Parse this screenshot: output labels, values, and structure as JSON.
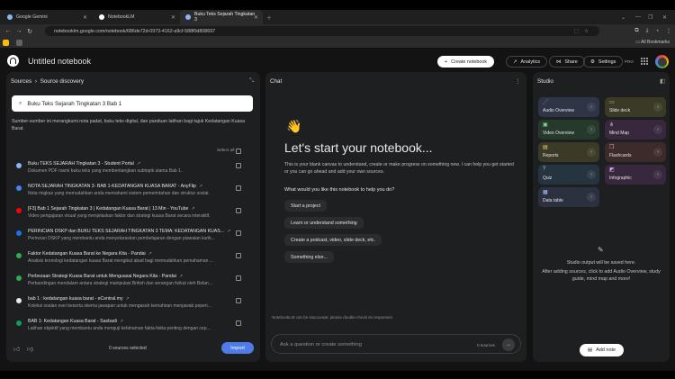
{
  "browser": {
    "tabs": [
      {
        "label": "Google Gemini",
        "color": "#8ab4f8"
      },
      {
        "label": "NotebookLM",
        "color": "#ffffff"
      },
      {
        "label": "Buku Teks Sejarah Tingkatan 3",
        "color": "#8ab4f8"
      }
    ],
    "url": "notebooklm.google.com/notebook/686de72d-0973-4162-a9cf-588f0d808697",
    "bookmarks_label": "All Bookmarks"
  },
  "header": {
    "title": "Untitled notebook",
    "create_label": "Create notebook",
    "analytics_label": "Analytics",
    "share_label": "Share",
    "settings_label": "Settings",
    "plan_badge": "PRO"
  },
  "sources": {
    "breadcrumb_root": "Sources",
    "breadcrumb_sep": "›",
    "breadcrumb_current": "Source discovery",
    "query": "Buku Teks Sejarah Tingkatan 3 Bab 1",
    "description": "Sumber-sumber ini merangkumi nota padat, buku teks digital, dan panduan latihan bagi tajuk Kedatangan Kuasa Barat.",
    "select_all_label": "Select all",
    "items": [
      {
        "title": "Buku TEKS SEJARAH Tingkatan 3 - Student Portal",
        "desc": "Dokumen PDF rasmi buku teks yang membentangkan subtopik utama Bab 1.",
        "icon_color": "#8ab4f8",
        "icon": "globe-icon"
      },
      {
        "title": "NOTA SEJARAH TINGKATAN 3- BAB 1-KEDATANGAN KUASA BARAT - AnyFlip",
        "desc": "Nota ringkas yang memudahkan anda memahami sistem pemerintahan dan struktur sosial.",
        "icon_color": "#4285f4",
        "icon": "anyflip-icon"
      },
      {
        "title": "[F3] Bab 1 Sejarah Tingkatan 3 | Kedatangan Kuasa Barat | 13 Min - YouTube",
        "desc": "Video pengajaran visual yang menjelaskan faktor dan strategi kuasa Barat secara interaktif.",
        "icon_color": "#ff0000",
        "icon": "youtube-icon"
      },
      {
        "title": "PERINCIAN DSKP dan BUKU TEKS SEJARAH TINGKATAN 3 TEMA: KEDATANGAN KUAS...",
        "desc": "Perincian DSKP yang membantu anda menyelaraskan pembelajaran dengan piawaian kurik...",
        "icon_color": "#1a73e8",
        "icon": "document-icon"
      },
      {
        "title": "Faktor Kedatangan Kuasa Barat ke Negara Kita - Pandai",
        "desc": "Analisis kronologi kedatangan kuasa Barat mengikut abad bagi memudahkan pemahaman ...",
        "icon_color": "#34a853",
        "icon": "pandai-icon"
      },
      {
        "title": "Perbezaan Strategi Kuasa Barat untuk Menguasai Negara Kita - Pandai",
        "desc": "Perbandingan mendalam antara strategi manipulasi British dan serangan fizikal oleh Belan...",
        "icon_color": "#34a853",
        "icon": "pandai-icon"
      },
      {
        "title": "bab 1 : kedatangan kuasa barat - eCentral.my",
        "desc": "Koleksi soalan esei beserta skema jawapan untuk mengasah kemahiran menjawab peperi...",
        "icon_color": "#e8eaed",
        "icon": "ecentral-icon"
      },
      {
        "title": "BAB 1: Kedatangan Kuasa Barat - Sasbadi",
        "desc": "Latihan objektif yang membantu anda menguji kefahaman fakta-fakta penting dengan cep...",
        "icon_color": "#0f9d58",
        "icon": "sasbadi-icon"
      }
    ],
    "selected_count": "0 sources selected",
    "import_label": "Import"
  },
  "chat": {
    "title": "Chat",
    "emoji": "👋",
    "heading": "Let's start your notebook...",
    "description": "This is your blank canvas to understand, create or make progress on something new. I can help you get started or you can go ahead and add your own sources.",
    "prompt": "What would you like this notebook to help you do?",
    "suggestions": [
      "Start a project",
      "Learn or understand something",
      "Create a podcast, video, slide deck, etc.",
      "Something else..."
    ],
    "input_placeholder": "Ask a question or create something",
    "source_count": "0 sources",
    "disclaimer": "NotebookLM can be inaccurate; please double-check its responses."
  },
  "studio": {
    "title": "Studio",
    "tiles": [
      {
        "label": "Audio Overview",
        "icon": "audio-overview-icon",
        "glyph": "⋰",
        "bg": "#2e3546",
        "fg": "#a8c7fa"
      },
      {
        "label": "Slide deck",
        "icon": "slide-deck-icon",
        "glyph": "▭",
        "bg": "#3b3a26",
        "fg": "#e6d57a"
      },
      {
        "label": "Video Overview",
        "icon": "video-overview-icon",
        "glyph": "▣",
        "bg": "#263a2c",
        "fg": "#8fd49c"
      },
      {
        "label": "Mind Map",
        "icon": "mind-map-icon",
        "glyph": "⋔",
        "bg": "#37283d",
        "fg": "#d9a8e8"
      },
      {
        "label": "Reports",
        "icon": "reports-icon",
        "glyph": "▤",
        "bg": "#3b3a26",
        "fg": "#e6d57a"
      },
      {
        "label": "Flashcards",
        "icon": "flashcards-icon",
        "glyph": "❐",
        "bg": "#3d2a2a",
        "fg": "#f0a6a0"
      },
      {
        "label": "Quiz",
        "icon": "quiz-icon",
        "glyph": "?",
        "bg": "#263440",
        "fg": "#94c7e8"
      },
      {
        "label": "Infographic",
        "icon": "infographic-icon",
        "glyph": "◩",
        "bg": "#37283d",
        "fg": "#d9a8e8"
      },
      {
        "label": "Data table",
        "icon": "data-table-icon",
        "glyph": "▦",
        "bg": "#2c3140",
        "fg": "#a8c7fa"
      }
    ],
    "empty_title": "Studio output will be saved here.",
    "empty_desc": "After adding sources, click to add Audio Overview, study guide, mind map and more!",
    "add_note_label": "Add note"
  }
}
